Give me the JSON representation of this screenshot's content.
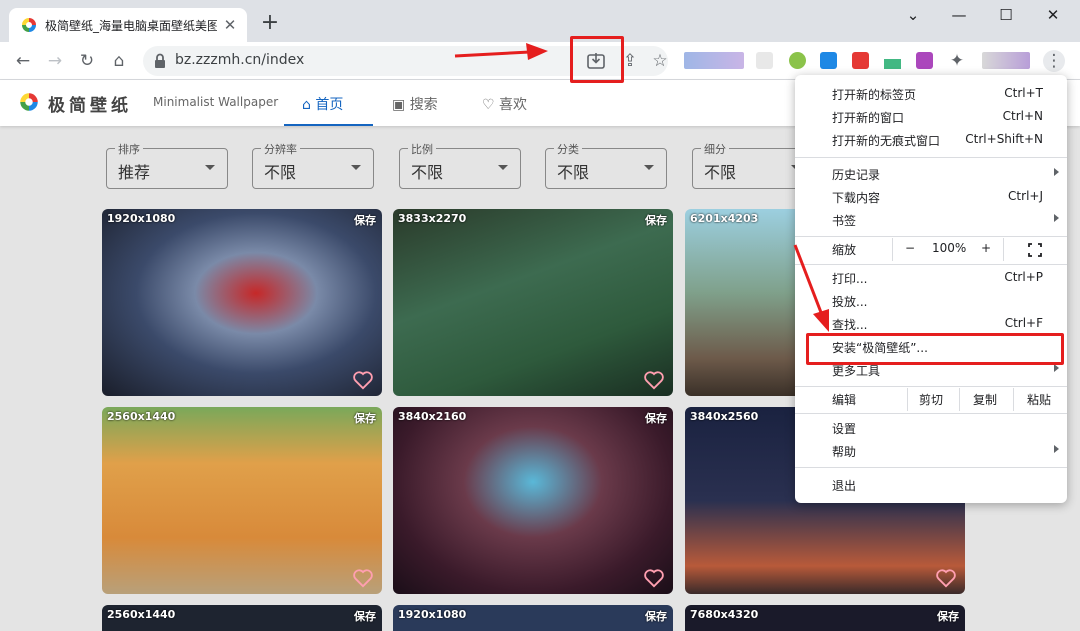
{
  "browser": {
    "tab_title": "极简壁纸_海量电脑桌面壁纸美图",
    "tab_close": "✕",
    "new_tab": "+",
    "window_controls": {
      "minimize": "—",
      "maximize": "☐",
      "close": "✕",
      "dropdown": "⌄"
    },
    "url": "bz.zzzmh.cn/index",
    "nav_icons": {
      "back": "←",
      "forward": "→",
      "reload": "↻",
      "home": "⌂"
    },
    "toolbar_icons": {
      "share": "⇪",
      "bookmark": "☆",
      "extensions": "✦",
      "menu": "⋮"
    }
  },
  "site": {
    "name": "极简壁纸",
    "subtitle": "Minimalist Wallpaper",
    "nav": [
      {
        "label": "首页",
        "icon": "home-icon",
        "active": true
      },
      {
        "label": "搜索",
        "icon": "image-search-icon",
        "active": false
      },
      {
        "label": "喜欢",
        "icon": "heart-icon",
        "active": false
      }
    ]
  },
  "filters": [
    {
      "label": "排序",
      "value": "推荐"
    },
    {
      "label": "分辨率",
      "value": "不限"
    },
    {
      "label": "比例",
      "value": "不限"
    },
    {
      "label": "分类",
      "value": "不限"
    },
    {
      "label": "细分",
      "value": "不限"
    }
  ],
  "save_label": "保存",
  "wallpapers": [
    {
      "resolution": "1920x1080"
    },
    {
      "resolution": "3833x2270"
    },
    {
      "resolution": "6201x4203"
    },
    {
      "resolution": "2560x1440"
    },
    {
      "resolution": "3840x2160"
    },
    {
      "resolution": "3840x2560"
    },
    {
      "resolution": "2560x1440"
    },
    {
      "resolution": "1920x1080"
    },
    {
      "resolution": "7680x4320"
    }
  ],
  "menu": {
    "new_tab": {
      "label": "打开新的标签页",
      "shortcut": "Ctrl+T"
    },
    "new_window": {
      "label": "打开新的窗口",
      "shortcut": "Ctrl+N"
    },
    "incognito": {
      "label": "打开新的无痕式窗口",
      "shortcut": "Ctrl+Shift+N"
    },
    "history": {
      "label": "历史记录"
    },
    "downloads": {
      "label": "下载内容",
      "shortcut": "Ctrl+J"
    },
    "bookmarks": {
      "label": "书签"
    },
    "zoom": {
      "label": "缩放",
      "minus": "−",
      "value": "100%",
      "plus": "+"
    },
    "print": {
      "label": "打印...",
      "shortcut": "Ctrl+P"
    },
    "cast": {
      "label": "投放..."
    },
    "find": {
      "label": "查找...",
      "shortcut": "Ctrl+F"
    },
    "install": {
      "label": "安装“极简壁纸”..."
    },
    "more_tools": {
      "label": "更多工具"
    },
    "edit": {
      "label": "编辑",
      "cut": "剪切",
      "copy": "复制",
      "paste": "粘贴"
    },
    "settings": {
      "label": "设置"
    },
    "help": {
      "label": "帮助"
    },
    "exit": {
      "label": "退出"
    }
  },
  "colors": {
    "annotation": "#e51e1e",
    "accent": "#1565c0"
  }
}
